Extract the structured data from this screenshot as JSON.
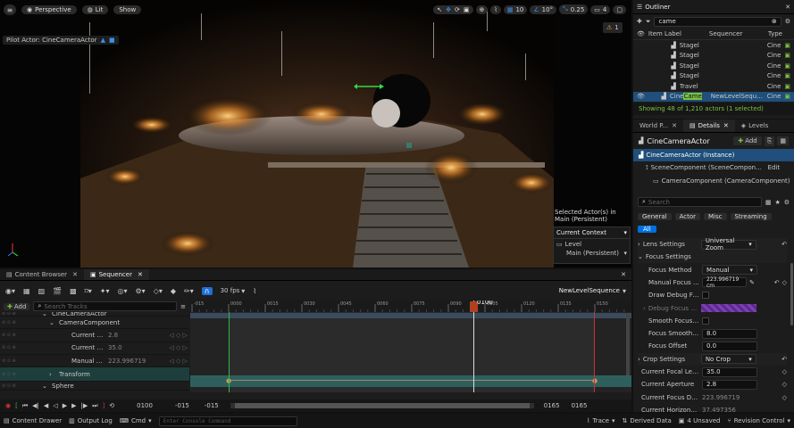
{
  "viewport": {
    "menu_icon": "hamburger-icon",
    "perspective": "Perspective",
    "lit": "Lit",
    "show": "Show",
    "grid_value": "10",
    "angle_value": "10°",
    "scale_value": "0.25",
    "camera_speed": "4",
    "pilot_label": "Pilot Actor: CineCameraActor",
    "warning_count": "1",
    "selected_info": "Selected Actor(s) in",
    "selected_info2": "Main (Persistent)",
    "context_title": "Current Context",
    "level_label": "Level",
    "level_value": "Main (Persistent)"
  },
  "sequencer": {
    "tabs": [
      "Content Browser",
      "Sequencer"
    ],
    "fps": "30 fps",
    "sequence_name": "NewLevelSequence",
    "add_label": "Add",
    "search_placeholder": "Search Tracks",
    "tracks": [
      {
        "name": "CineCameraActor",
        "value": ""
      },
      {
        "name": "CameraComponent",
        "value": ""
      },
      {
        "name": "Current Ape",
        "value": "2.8"
      },
      {
        "name": "Current Foc",
        "value": "35.0"
      },
      {
        "name": "Manual Foc",
        "value": "223.996719"
      },
      {
        "name": "Transform",
        "value": ""
      },
      {
        "name": "Sphere",
        "value": ""
      }
    ],
    "ruler_ticks": [
      "-015",
      "0000",
      "0015",
      "0030",
      "0045",
      "0060",
      "0075",
      "0090",
      "0105",
      "0120",
      "0135",
      "0150"
    ],
    "playhead": "0100",
    "current_frame": "0100",
    "start_a": "-015",
    "start_b": "-015",
    "end_a": "0165",
    "end_b": "0165"
  },
  "outliner": {
    "title": "Outliner",
    "search_value": "came",
    "col_label": "Item Label",
    "col_seq": "Sequencer",
    "col_type": "Type",
    "rows": [
      {
        "label": "Stagel",
        "seq": "",
        "type": "Cine"
      },
      {
        "label": "Stagel",
        "seq": "",
        "type": "Cine"
      },
      {
        "label": "Stagel",
        "seq": "",
        "type": "Cine"
      },
      {
        "label": "Stagel",
        "seq": "",
        "type": "Cine"
      },
      {
        "label": "Travel",
        "seq": "",
        "type": "Cine"
      },
      {
        "label": "Cine",
        "highlight": "Came",
        "seq": "NewLevelSequence",
        "type": "Cine"
      }
    ],
    "status": "Showing 48 of 1,210 actors (1 selected)"
  },
  "details": {
    "tabs": [
      "World P...",
      "Details",
      "Levels"
    ],
    "actor_name": "CineCameraActor",
    "add_label": "Add",
    "instance": "CineCameraActor (Instance)",
    "scene_component": "SceneComponent (SceneComponent)",
    "edit": "Edit",
    "camera_component": "CameraComponent (CameraComponent)",
    "search_placeholder": "Search",
    "filters": [
      "General",
      "Actor",
      "Misc",
      "Streaming",
      "All"
    ],
    "lens_settings": "Lens Settings",
    "lens_value": "Universal Zoom",
    "focus_settings": "Focus Settings",
    "focus_method": "Focus Method",
    "focus_method_value": "Manual",
    "manual_focus": "Manual Focus Di...",
    "manual_focus_value": "223.996719 cm",
    "draw_debug": "Draw Debug Foc...",
    "debug_plane": "Debug Focus Pla...",
    "smooth_focus": "Smooth Focus C...",
    "focus_smoothing": "Focus Smoothin...",
    "focus_smoothing_value": "8.0",
    "focus_offset": "Focus Offset",
    "focus_offset_value": "0.0",
    "crop_settings": "Crop Settings",
    "crop_value": "No Crop",
    "focal_length": "Current Focal Length",
    "focal_length_value": "35.0",
    "aperture": "Current Aperture",
    "aperture_value": "2.8",
    "focus_distance": "Current Focus Dista...",
    "focus_distance_value": "223.996719",
    "horizontal_fov": "Current Horizontal F...",
    "horizontal_fov_value": "37.497356"
  },
  "statusbar": {
    "content_drawer": "Content Drawer",
    "output_log": "Output Log",
    "cmd": "Cmd",
    "console_placeholder": "Enter Console Command",
    "trace": "Trace",
    "derived": "Derived Data",
    "unsaved": "4 Unsaved",
    "revision": "Revision Control"
  },
  "colors": {
    "accent": "#0070e0",
    "selection": "#1f4f7a",
    "green": "#7bc043"
  }
}
